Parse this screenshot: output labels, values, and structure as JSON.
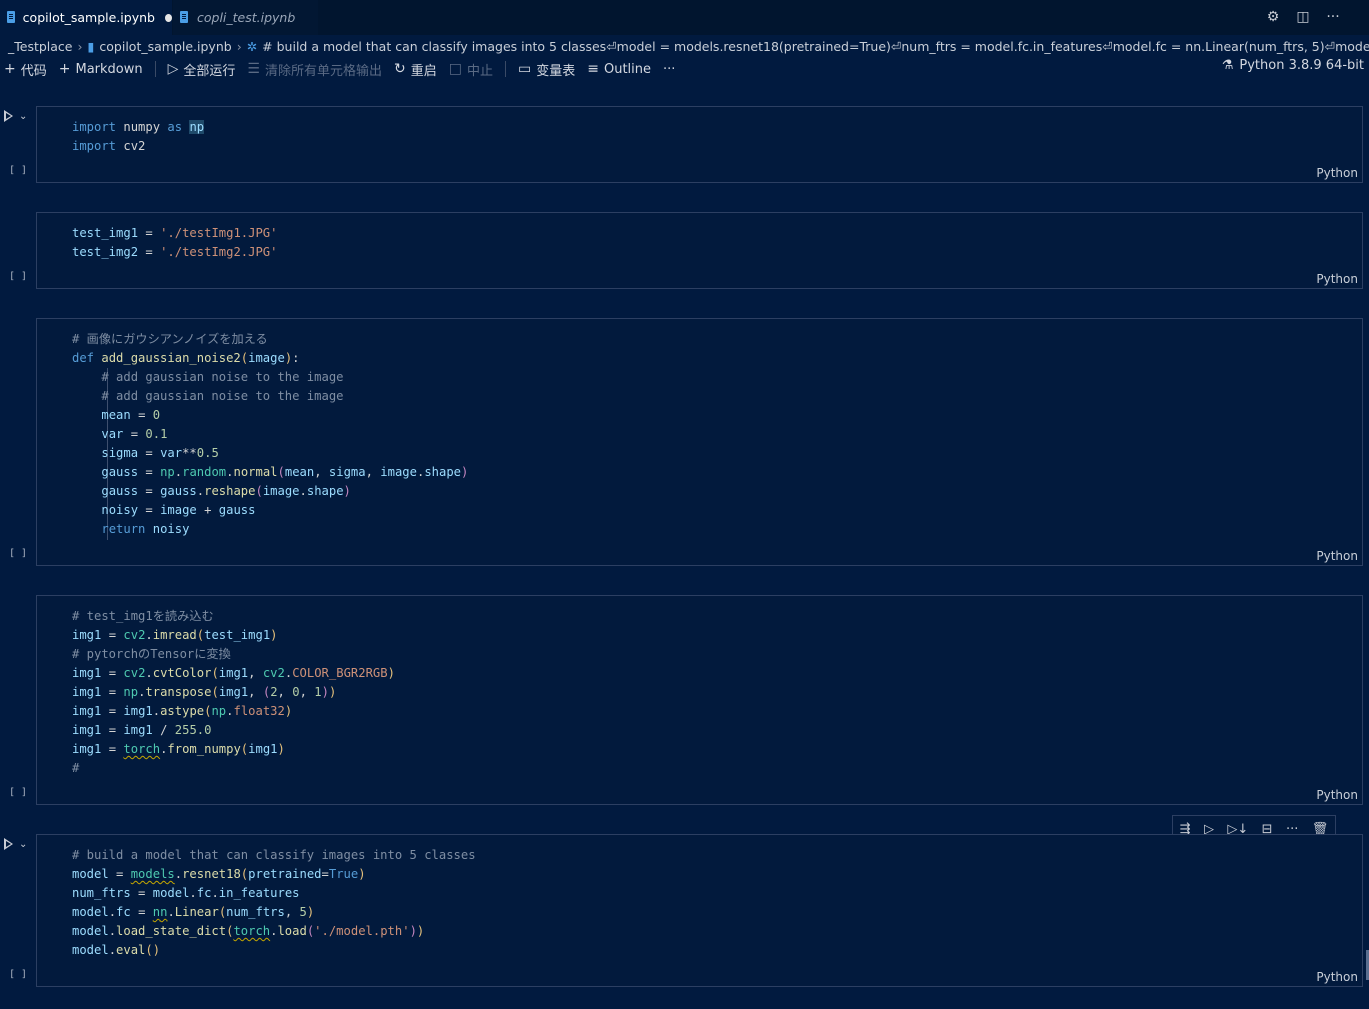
{
  "tabs": [
    {
      "label": "copilot_sample.ipynb",
      "active": true,
      "modified": true
    },
    {
      "label": "copli_test.ipynb",
      "active": false,
      "modified": false
    }
  ],
  "breadcrumb": {
    "folder": "_Testplace",
    "file": "copilot_sample.ipynb",
    "cell": "# build a model that can classify images into 5 classes⏎model = models.resnet18(pretrained=True)⏎num_ftrs = model.fc.in_features⏎model.fc = nn.Linear(num_ftrs, 5)⏎model.load_state_di..."
  },
  "toolbar": {
    "code": "代码",
    "markdown": "Markdown",
    "run_all": "全部运行",
    "clear_outputs": "清除所有单元格输出",
    "restart": "重启",
    "interrupt": "中止",
    "variables": "变量表",
    "outline": "Outline",
    "more": "···",
    "kernel": "Python 3.8.9 64-bit"
  },
  "cells": [
    {
      "lang": "Python",
      "exec": "[ ]"
    },
    {
      "lang": "Python",
      "exec": "[ ]"
    },
    {
      "lang": "Python",
      "exec": "[ ]"
    },
    {
      "lang": "Python",
      "exec": "[ ]"
    },
    {
      "lang": "Python",
      "exec": "[ ]"
    }
  ],
  "code": {
    "c1": [
      "import numpy as np",
      "import cv2"
    ],
    "c2": [
      "test_img1 = './testImg1.JPG'",
      "test_img2 = './testImg2.JPG'"
    ],
    "c3": [
      "# 画像にガウシアンノイズを加える",
      "def add_gaussian_noise2(image):",
      "    # add gaussian noise to the image",
      "    # add gaussian noise to the image",
      "    mean = 0",
      "    var = 0.1",
      "    sigma = var**0.5",
      "    gauss = np.random.normal(mean, sigma, image.shape)",
      "    gauss = gauss.reshape(image.shape)",
      "    noisy = image + gauss",
      "    return noisy"
    ],
    "c4": [
      "# test_img1を読み込む",
      "img1 = cv2.imread(test_img1)",
      "# pytorchのTensorに変換",
      "img1 = cv2.cvtColor(img1, cv2.COLOR_BGR2RGB)",
      "img1 = np.transpose(img1, (2, 0, 1))",
      "img1 = img1.astype(np.float32)",
      "img1 = img1 / 255.0",
      "img1 = torch.from_numpy(img1)",
      "#"
    ],
    "c5": [
      "# build a model that can classify images into 5 classes",
      "model = models.resnet18(pretrained=True)",
      "num_ftrs = model.fc.in_features",
      "model.fc = nn.Linear(num_ftrs, 5)",
      "model.load_state_dict(torch.load('./model.pth'))",
      "model.eval()"
    ]
  },
  "colors": {
    "background": "#011a3f",
    "keyword": "#569cd6",
    "string": "#ce9178",
    "number": "#b5cea8",
    "function": "#dcdcaa"
  }
}
